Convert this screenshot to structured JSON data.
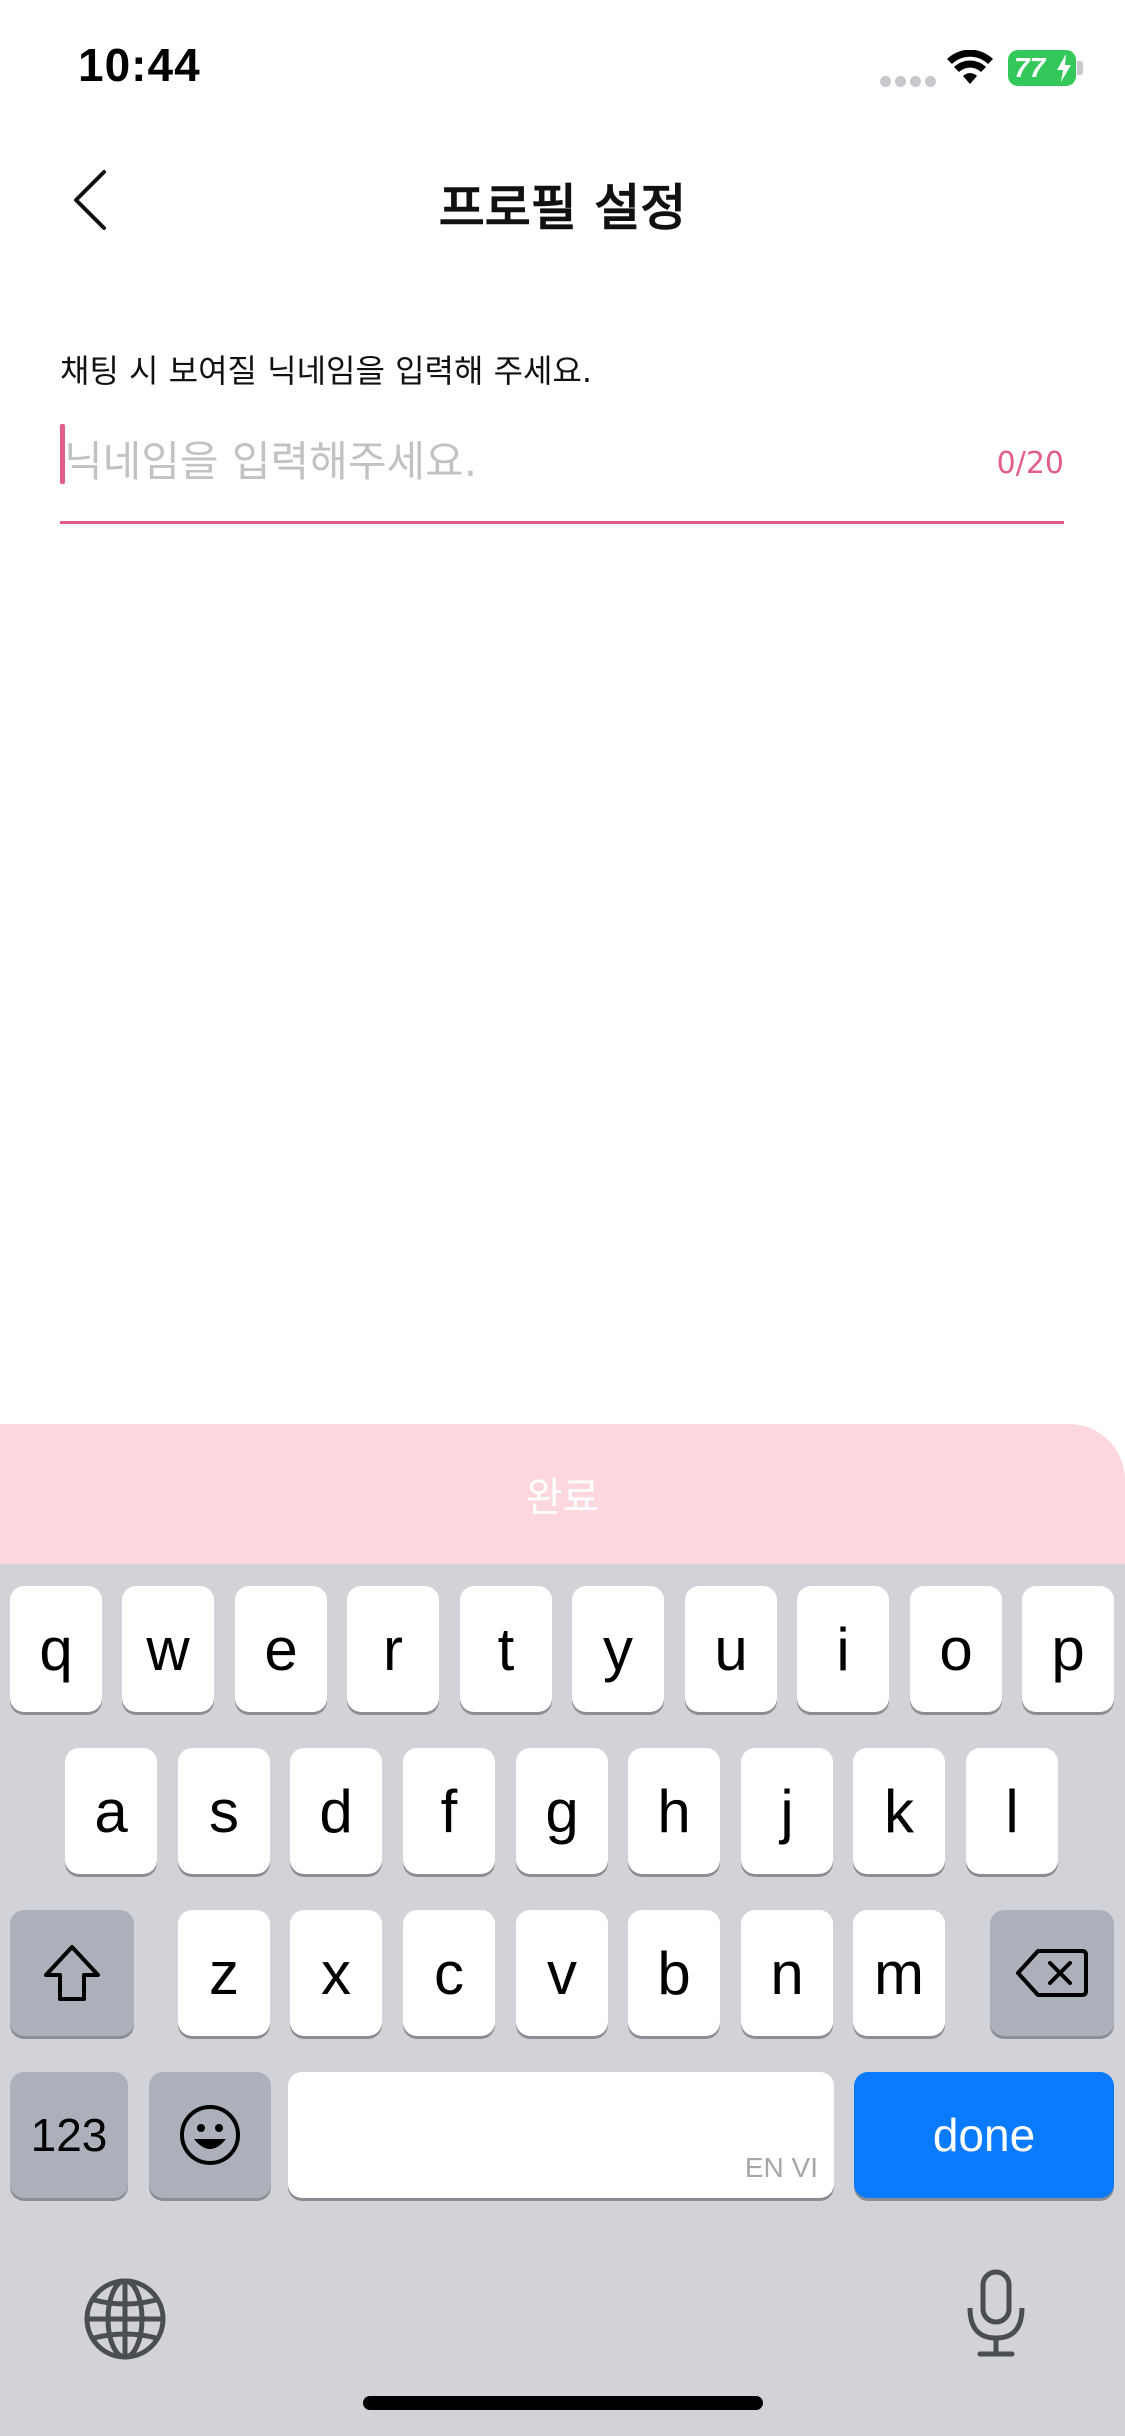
{
  "status_bar": {
    "time": "10:44",
    "battery": "77"
  },
  "header": {
    "title": "프로필 설정"
  },
  "form": {
    "label": "채팅 시 보여질 닉네임을 입력해 주세요.",
    "nickname_value": "",
    "nickname_placeholder": "닉네임을 입력해주세요.",
    "counter": "0/20"
  },
  "done_bar": {
    "label": "완료"
  },
  "keyboard": {
    "row1": [
      "q",
      "w",
      "e",
      "r",
      "t",
      "y",
      "u",
      "i",
      "o",
      "p"
    ],
    "row2": [
      "a",
      "s",
      "d",
      "f",
      "g",
      "h",
      "j",
      "k",
      "l"
    ],
    "row3": [
      "z",
      "x",
      "c",
      "v",
      "b",
      "n",
      "m"
    ],
    "numbers_label": "123",
    "space_hint": "EN VI",
    "return_label": "done"
  },
  "colors": {
    "accent": "#e35d8a",
    "done_bar": "#fcd8de",
    "keyboard_bg": "#d1d3d9",
    "return_key": "#0a7aff"
  },
  "icons": {
    "back": "chevron-left-icon",
    "shift": "shift-arrow-icon",
    "delete": "backspace-icon",
    "emoji": "emoji-icon",
    "globe": "globe-icon",
    "mic": "microphone-icon",
    "wifi": "wifi-icon",
    "battery": "battery-icon"
  }
}
